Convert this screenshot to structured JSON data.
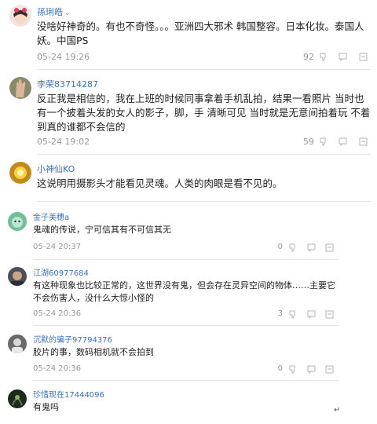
{
  "comments": [
    {
      "user": "孫琍皓",
      "text": "没啥好神奇的。有也不奇怪。。。亚洲四大邪术 韩国整容。日本化妆。泰国人妖。中国PS",
      "time": "05-24 19:26",
      "likes": "92"
    },
    {
      "user": "李荣83714287",
      "text": "反正我是相信的，我在上班的时候同事拿着手机乱拍，结果一看照片 当时也有一个披着头发的女人的影子，脚，手 清晰可见 当时就是无意间拍着玩 不着到真的谁都不会信的",
      "time": "05-24 19:02",
      "likes": "59"
    },
    {
      "user": "小神仙KO",
      "text": "这说明用摄影头才能看见灵魂。人类的肉眼是看不见的。",
      "time": "",
      "likes": ""
    },
    {
      "user": "金子美穗a",
      "text": "鬼魂的传说，宁可信其有不可信其无",
      "time": "05-24 20:37",
      "likes": "0"
    },
    {
      "user": "江湖60977684",
      "text": "有这种现象也比较正常的，这世界没有鬼，但会存在灵异空间的物体……主要它不会伤害人，没什么大惊小怪的",
      "time": "05-24 20:36",
      "likes": "3"
    },
    {
      "user": "沉默的骗子97794376",
      "text": "胶片的事，数码相机就不会拍到",
      "time": "05-24 20:36",
      "likes": "0"
    },
    {
      "user": "珍惜现在17444096",
      "text": "有鬼吗",
      "time": "",
      "likes": ""
    }
  ],
  "corner_mark": "↵",
  "icons": [
    "avatar",
    "chevron-down-icon",
    "thumbs-down-icon",
    "reply-icon",
    "report-icon"
  ]
}
